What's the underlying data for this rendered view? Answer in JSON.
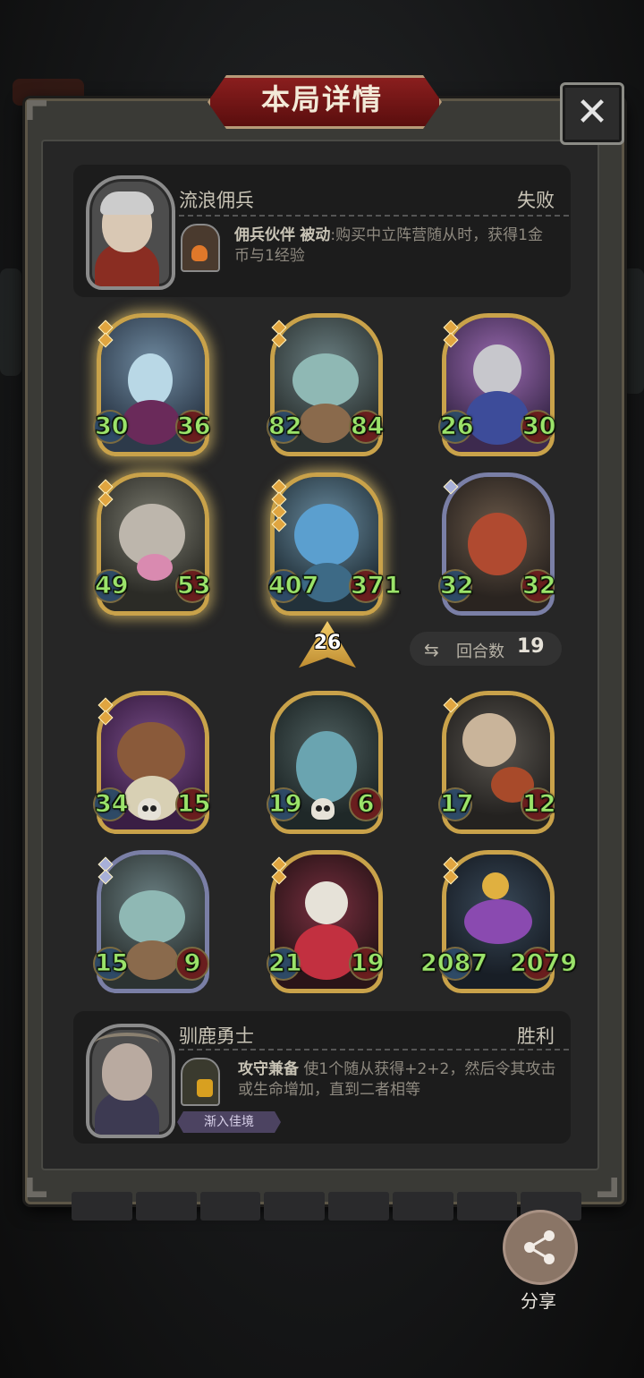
{
  "window_title": "本局详情",
  "close_icon": "close-x-icon",
  "opponent": {
    "name": "流浪佣兵",
    "result": "失败",
    "skill_name": "佣兵伙伴",
    "skill_type": "被动",
    "skill_desc": ":购买中立阵营随从时，获得1金币与1经验"
  },
  "board_opponent": [
    {
      "attack": "30",
      "health": "36"
    },
    {
      "attack": "82",
      "health": "84"
    },
    {
      "attack": "26",
      "health": "30"
    },
    {
      "attack": "49",
      "health": "53"
    },
    {
      "attack": "407",
      "health": "371"
    },
    {
      "attack": "32",
      "health": "32"
    }
  ],
  "tier": "26",
  "rounds": {
    "label": "回合数",
    "value": "19"
  },
  "board_player": [
    {
      "attack": "34",
      "health": "15"
    },
    {
      "attack": "19",
      "health": "6"
    },
    {
      "attack": "17",
      "health": "12"
    },
    {
      "attack": "15",
      "health": "9"
    },
    {
      "attack": "21",
      "health": "19"
    },
    {
      "attack": "2087",
      "health": "2079"
    }
  ],
  "player": {
    "name": "驯鹿勇士",
    "result": "胜利",
    "skill_name": "攻守兼备",
    "skill_desc": " 使1个随从获得+2+2，然后令其攻击或生命增加，直到二者相等",
    "tag": "渐入佳境"
  },
  "share_label": "分享"
}
